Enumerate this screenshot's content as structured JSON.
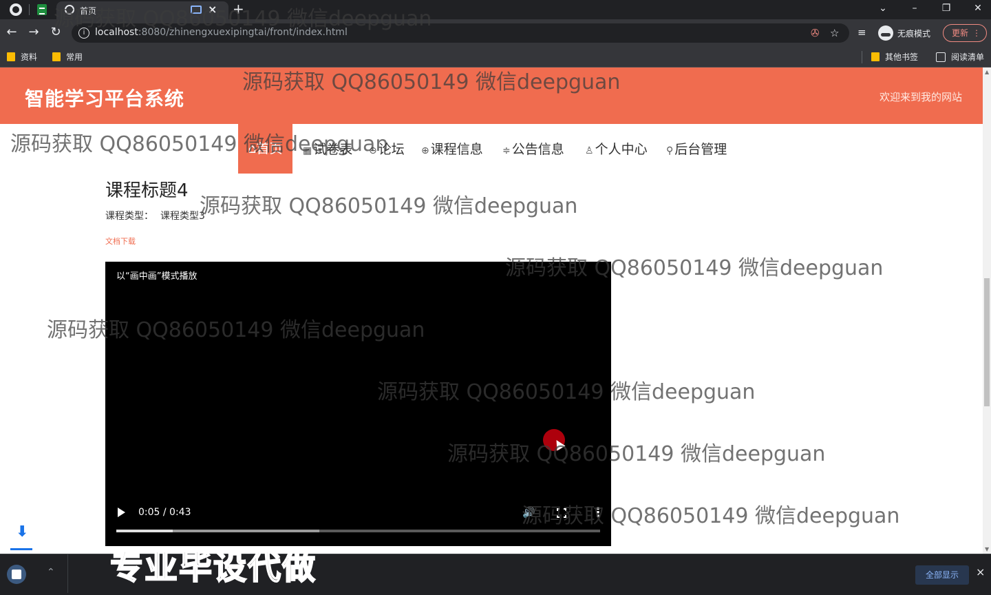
{
  "browser": {
    "tab_title": "首页",
    "tab_close": "×",
    "new_tab": "+",
    "url_host": "localhost",
    "url_path": ":8080/zhinengxuexipingtai/front/index.html",
    "incognito_label": "无痕模式",
    "update_label": "更新",
    "bookmarks": [
      "资料",
      "常用"
    ],
    "other_bookmarks": "其他书签",
    "reading_list": "阅读清单"
  },
  "site": {
    "title": "智能学习平台系统",
    "welcome": "欢迎来到我的网站",
    "nav": [
      {
        "label": "首页",
        "icon": "home-icon"
      },
      {
        "label": "试卷表",
        "icon": "table-icon"
      },
      {
        "label": "论坛",
        "icon": "forum-icon"
      },
      {
        "label": "课程信息",
        "icon": "globe-icon"
      },
      {
        "label": "公告信息",
        "icon": "sliders-icon"
      },
      {
        "label": "个人中心",
        "icon": "user-icon"
      },
      {
        "label": "后台管理",
        "icon": "link-icon"
      }
    ],
    "nav_glyphs": {
      "home": "⌂",
      "table": "▦",
      "forum": "⊖",
      "globe": "⊕",
      "sliders": "≑",
      "user": "♙",
      "link": "⚲"
    }
  },
  "course": {
    "title": "课程标题4",
    "type_label": "课程类型：",
    "type_value": "课程类型3",
    "doc_link": "文档下载"
  },
  "video": {
    "pip_label": "以“画中画”模式播放",
    "time": "0:05 / 0:43",
    "current_seconds": 5,
    "duration_seconds": 43,
    "buffered_fraction": 0.42
  },
  "overlays": {
    "watermark_text": "源码获取 QQ86050149 微信deepguan",
    "caption": "专业毕设代做"
  },
  "download_shelf": {
    "show_all": "全部显示",
    "close": "×"
  },
  "colors": {
    "brand": "#f06c4f",
    "download_accent": "#1a73e8"
  }
}
